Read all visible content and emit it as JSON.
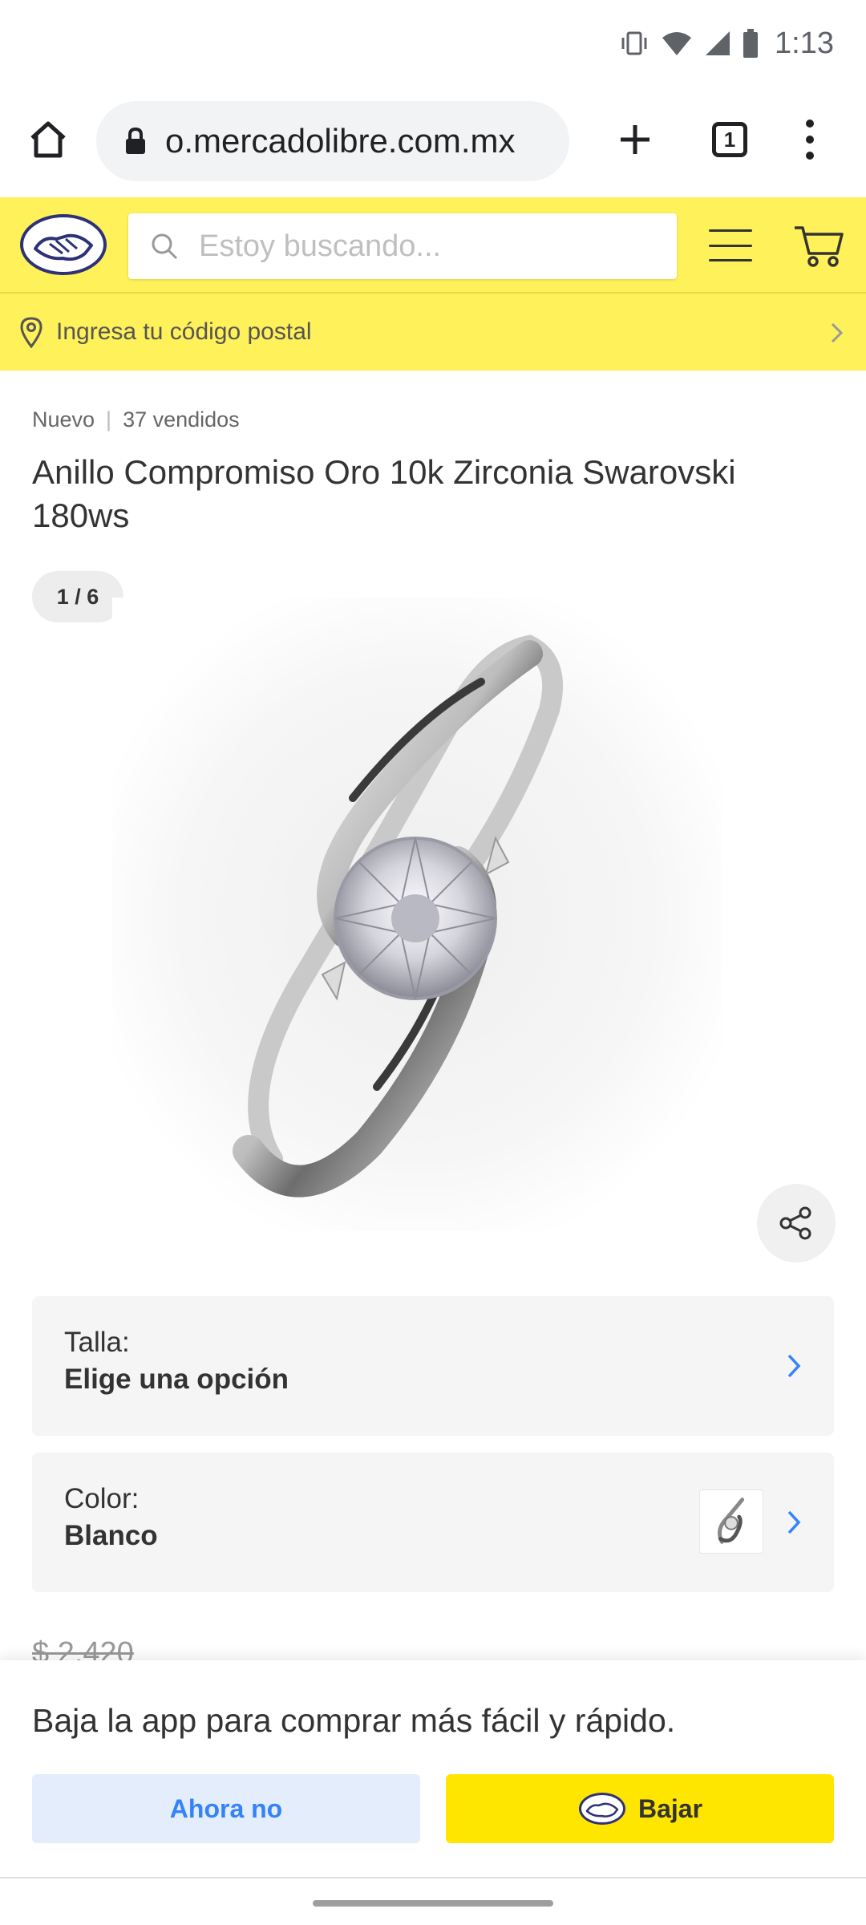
{
  "status_bar": {
    "time": "1:13",
    "icons": [
      "vibrate-icon",
      "wifi-icon",
      "signal-icon",
      "battery-icon"
    ]
  },
  "browser": {
    "url": "o.mercadolibre.com.mx",
    "tab_count": "1"
  },
  "header": {
    "search_placeholder": "Estoy buscando...",
    "postal_prompt": "Ingresa tu código postal"
  },
  "product": {
    "condition": "Nuevo",
    "sold": "37 vendidos",
    "title": "Anillo Compromiso Oro 10k Zirconia Swarovski 180ws",
    "gallery_counter": "1 / 6",
    "variants": [
      {
        "label": "Talla:",
        "value": "Elige una opción"
      },
      {
        "label": "Color:",
        "value": "Blanco"
      }
    ],
    "old_price": "$ 2,420"
  },
  "app_banner": {
    "text": "Baja la app para comprar más fácil y rápido.",
    "not_now_label": "Ahora no",
    "download_label": "Bajar"
  },
  "colors": {
    "brand_yellow": "#fff159",
    "accent_blue": "#3483fa",
    "button_yellow": "#ffe600"
  }
}
